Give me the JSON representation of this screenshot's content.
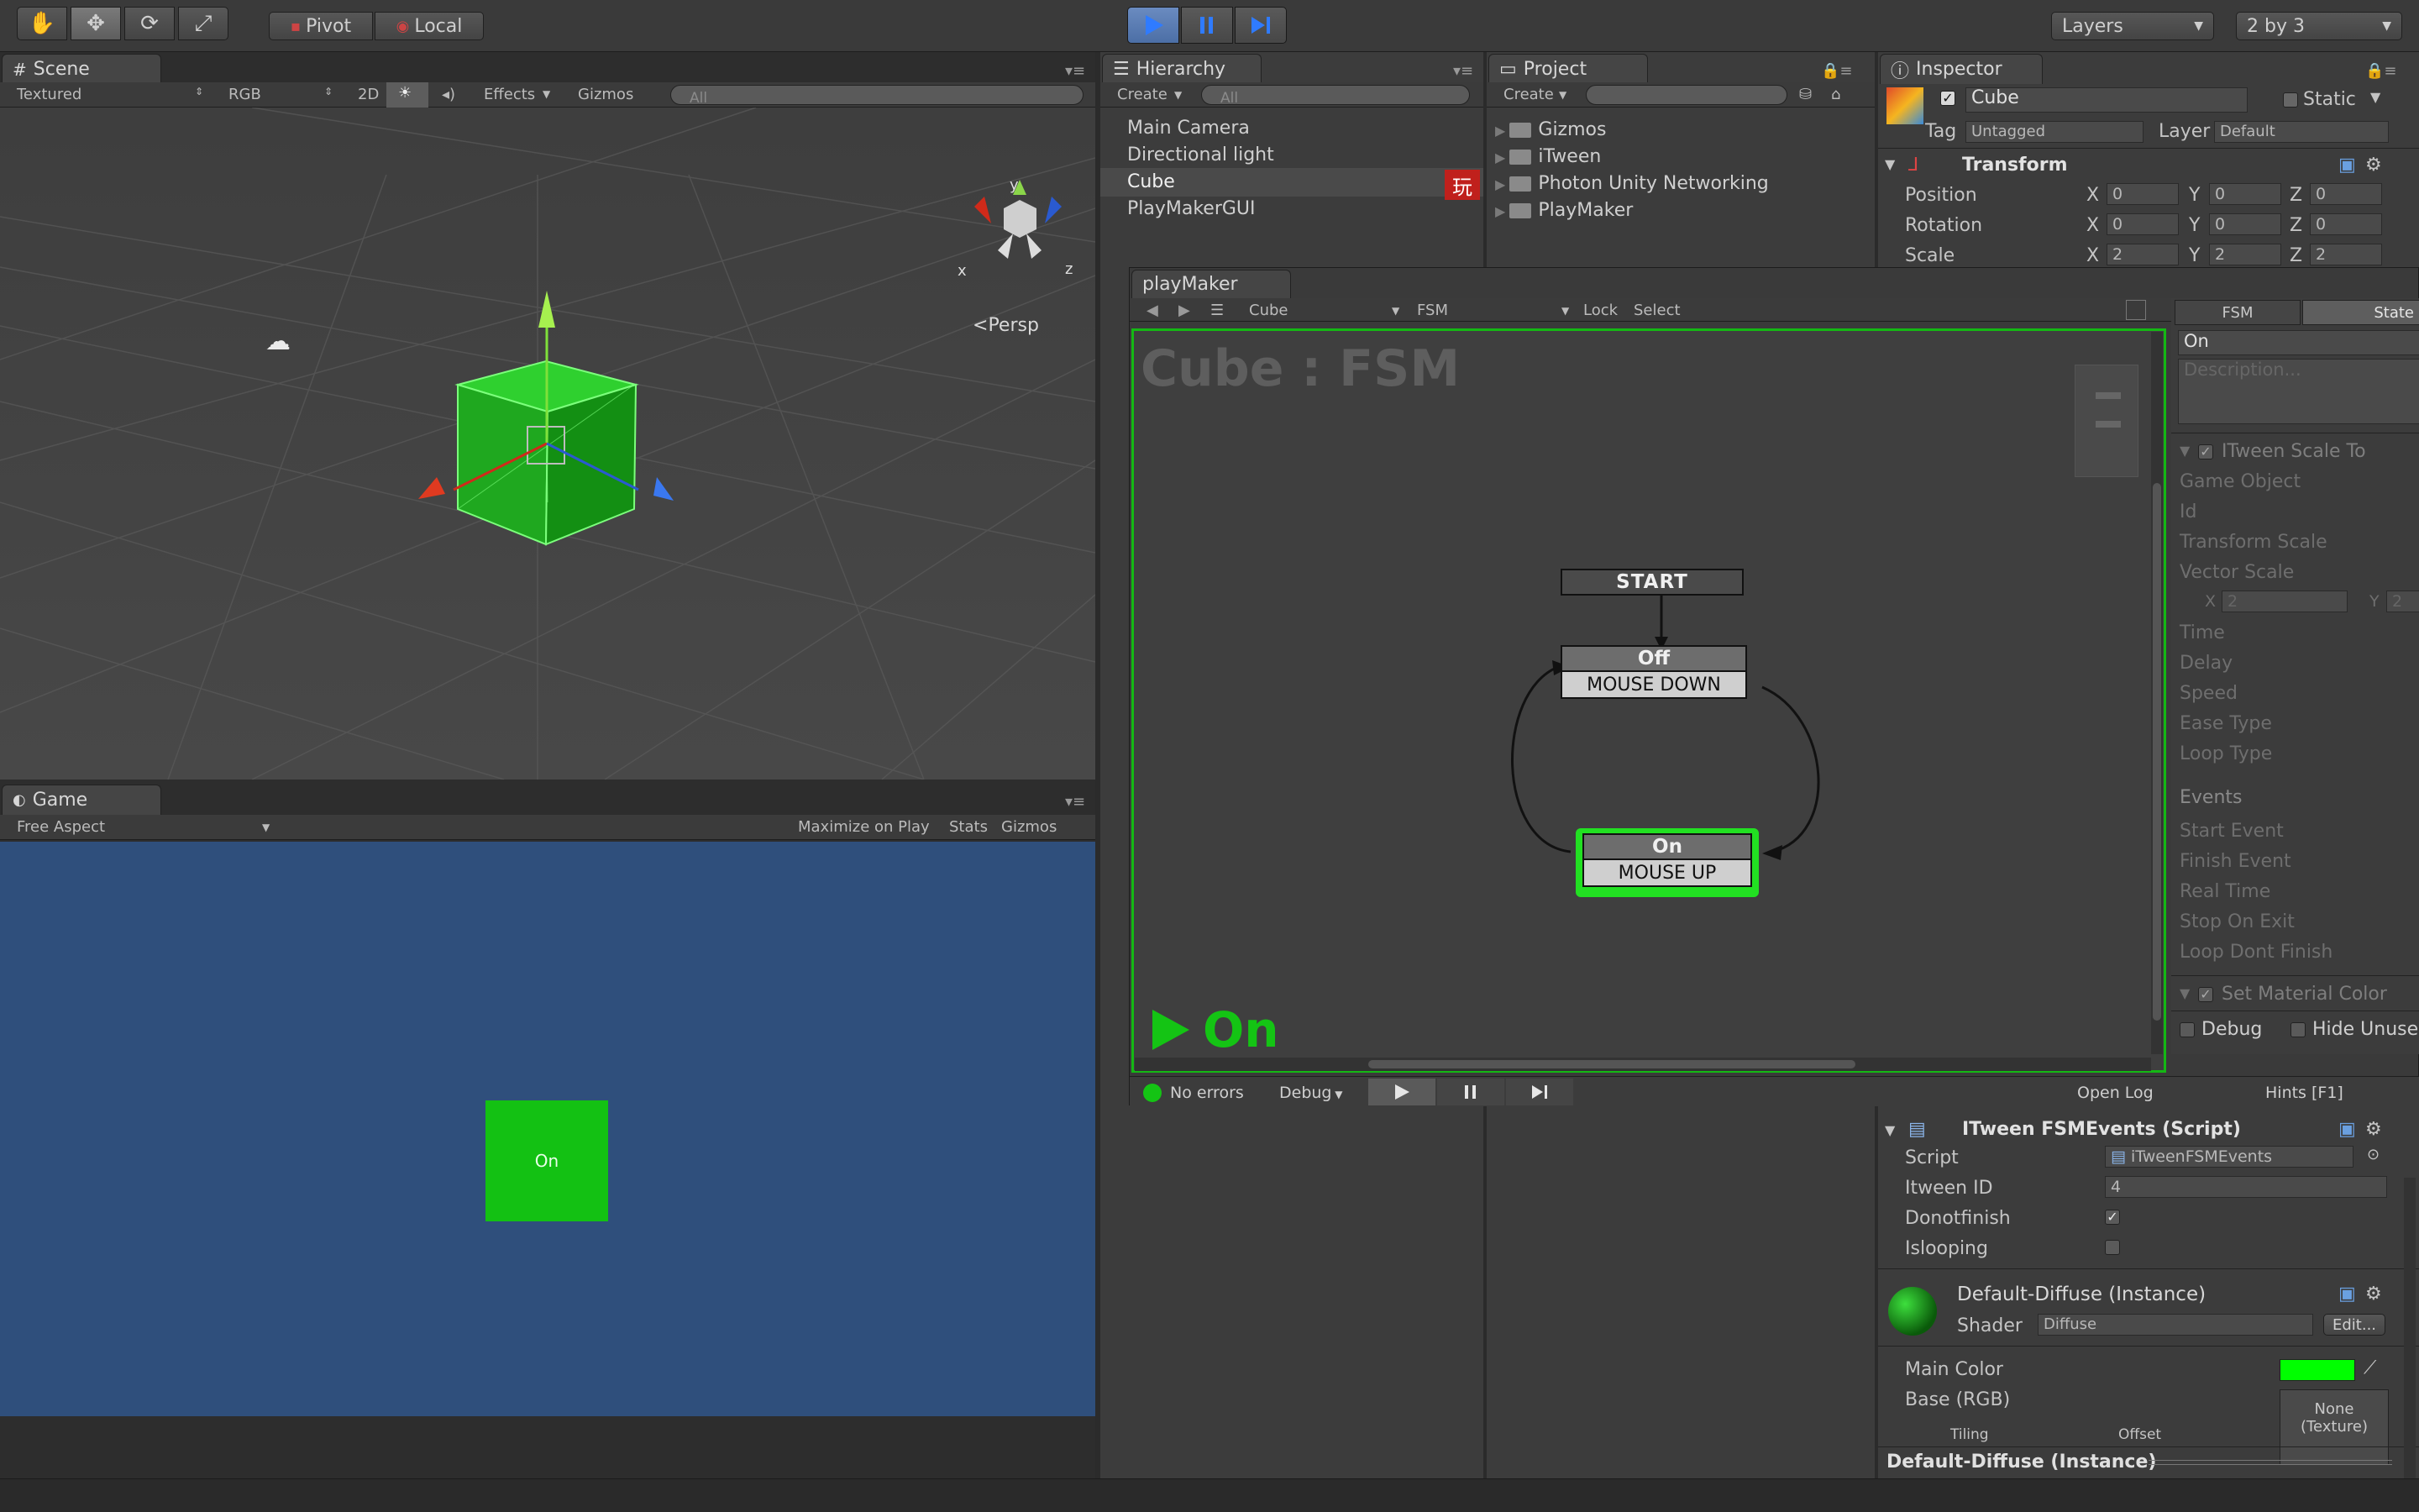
{
  "toolbar": {
    "pivot_label": "Pivot",
    "local_label": "Local",
    "layers_label": "Layers",
    "layout_label": "2 by 3"
  },
  "scene": {
    "tab_label": "Scene",
    "shading": "Textured",
    "render_mode": "RGB",
    "mode_2d": "2D",
    "effects_label": "Effects",
    "gizmos_label": "Gizmos",
    "search_placeholder": "All",
    "persp_label": "Persp",
    "axis_x": "x",
    "axis_y": "y",
    "axis_z": "z"
  },
  "game": {
    "tab_label": "Game",
    "aspect": "Free Aspect",
    "maximize_label": "Maximize on Play",
    "stats_label": "Stats",
    "gizmos_label": "Gizmos",
    "button_label": "On",
    "bg_color": "#2f4f7c"
  },
  "hierarchy": {
    "tab_label": "Hierarchy",
    "create_label": "Create",
    "search_placeholder": "All",
    "items": [
      "Main Camera",
      "Directional light",
      "Cube",
      "PlayMakerGUI"
    ],
    "playmaker_badge": "玩"
  },
  "project": {
    "tab_label": "Project",
    "create_label": "Create",
    "folders": [
      "Gizmos",
      "iTween",
      "Photon Unity Networking",
      "PlayMaker"
    ]
  },
  "inspector": {
    "tab_label": "Inspector",
    "object_name": "Cube",
    "static_label": "Static",
    "tag_label": "Tag",
    "tag_value": "Untagged",
    "layer_label": "Layer",
    "layer_value": "Default",
    "transform_label": "Transform",
    "position_label": "Position",
    "rotation_label": "Rotation",
    "scale_label": "Scale",
    "position": [
      "0",
      "0",
      "0"
    ],
    "rotation": [
      "0",
      "0",
      "0"
    ],
    "scale": [
      "2",
      "2",
      "2"
    ],
    "axis_x": "X",
    "axis_y": "Y",
    "axis_z": "Z",
    "script_component": "ITween FSMEvents (Script)",
    "script_label": "Script",
    "script_value": "iTweenFSMEvents",
    "itween_id_label": "Itween ID",
    "itween_id_value": "4",
    "donotfinish_label": "Donotfinish",
    "islooping_label": "Islooping",
    "material_name": "Default-Diffuse (Instance)",
    "shader_label": "Shader",
    "shader_value": "Diffuse",
    "edit_label": "Edit...",
    "main_color_label": "Main Color",
    "main_color": "#00ff00",
    "base_label": "Base (RGB)",
    "texture_none": "None",
    "texture_label": "(Texture)",
    "tiling_label": "Tiling",
    "offset_label": "Offset",
    "footer_label": "Default-Diffuse (Instance)"
  },
  "playmaker": {
    "tab_label": "playMaker",
    "object_select": "Cube",
    "fsm_select": "FSM",
    "lock_label": "Lock",
    "select_label": "Select",
    "graph_title": "Cube : FSM",
    "start_label": "START",
    "off_state": "Off",
    "off_event": "MOUSE DOWN",
    "on_state": "On",
    "on_event": "MOUSE UP",
    "active_state": "On",
    "errors_label": "No errors",
    "debug_label": "Debug",
    "open_log_label": "Open Log",
    "hints_label": "Hints [F1]",
    "side_tabs": [
      "FSM",
      "State"
    ],
    "state_name": "On",
    "description_placeholder": "Description...",
    "action1_title": "ITween Scale To",
    "action1_fields": [
      "Game Object",
      "Id",
      "Transform Scale",
      "Vector Scale"
    ],
    "vector_x_label": "X",
    "vector_x_value": "2",
    "vector_y_label": "Y",
    "vector_y_value": "2",
    "action1_fields2": [
      "Time",
      "Delay",
      "Speed",
      "Ease Type",
      "Loop Type"
    ],
    "events_label": "Events",
    "event_fields": [
      "Start Event",
      "Finish Event",
      "Real Time",
      "Stop On Exit",
      "Loop Dont Finish"
    ],
    "action2_title": "Set Material Color",
    "debug_check_label": "Debug",
    "hide_unused_label": "Hide Unused"
  }
}
